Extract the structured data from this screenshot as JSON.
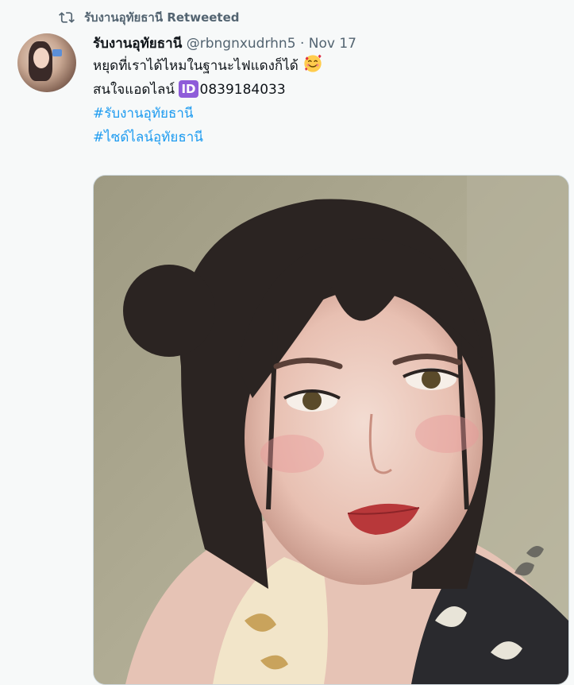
{
  "retweet": {
    "icon": "retweet-icon",
    "label": "รับงานอุทัยธานี Retweeted"
  },
  "tweet": {
    "author_name": "รับงานอุทัยธานี",
    "handle": "@rbngnxudrhn5",
    "separator": "·",
    "date": "Nov 17",
    "line1": "หยุดที่เราได้ไหมในฐานะไฟแดงก็ได้",
    "line1_emoji": "smiling-face-with-hearts-icon",
    "line2_prefix": "สนใจแอดไลน์",
    "id_badge": "ID",
    "line2_phone": "0839184033",
    "hashtags": [
      "#รับงานอุทัยธานี",
      "#ไซด์ไลน์อุทัยธานี"
    ]
  },
  "colors": {
    "link": "#1d9bf0",
    "muted": "#536471",
    "id_badge": "#8e5cd9"
  }
}
